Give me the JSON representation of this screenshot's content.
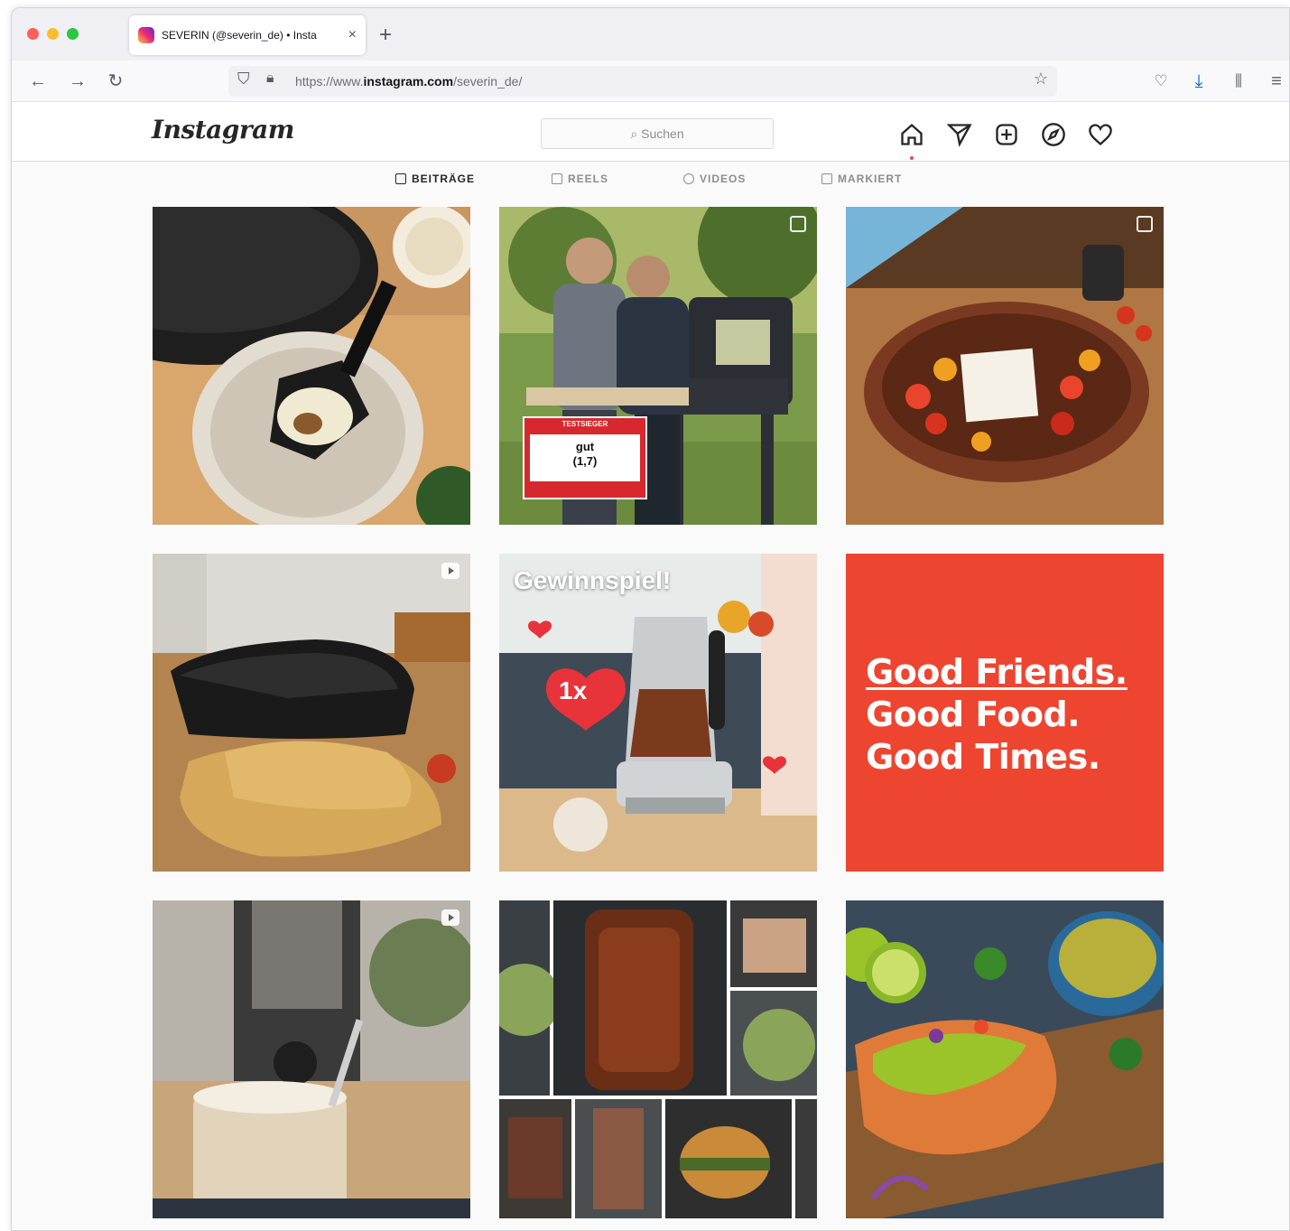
{
  "browser": {
    "tab_title": "SEVERIN (@severin_de) • Insta",
    "tab_close": "×",
    "new_tab": "+",
    "url_prefix": "https://www.",
    "url_domain": "instagram.com",
    "url_path": "/severin_de/"
  },
  "instagram": {
    "logo": "Instagram",
    "search_placeholder": "⌕ Suchen",
    "tabs": [
      "BEITRÄGE",
      "REELS",
      "VIDEOS",
      "MARKIERT"
    ],
    "active_tab": "BEITRÄGE"
  },
  "posts": {
    "grill_badge_header": "TESTSIEGER",
    "grill_badge_grade": "gut",
    "grill_badge_score": "(1,7)",
    "contest_title": "Gewinnspiel!",
    "contest_count": "1x",
    "slogan_lines": [
      "Good Friends.",
      "Good Food.",
      "Good Times."
    ]
  },
  "colors": {
    "slogan_bg": "#ee4530",
    "heart": "#e8333b",
    "accent_download": "#0060df"
  }
}
